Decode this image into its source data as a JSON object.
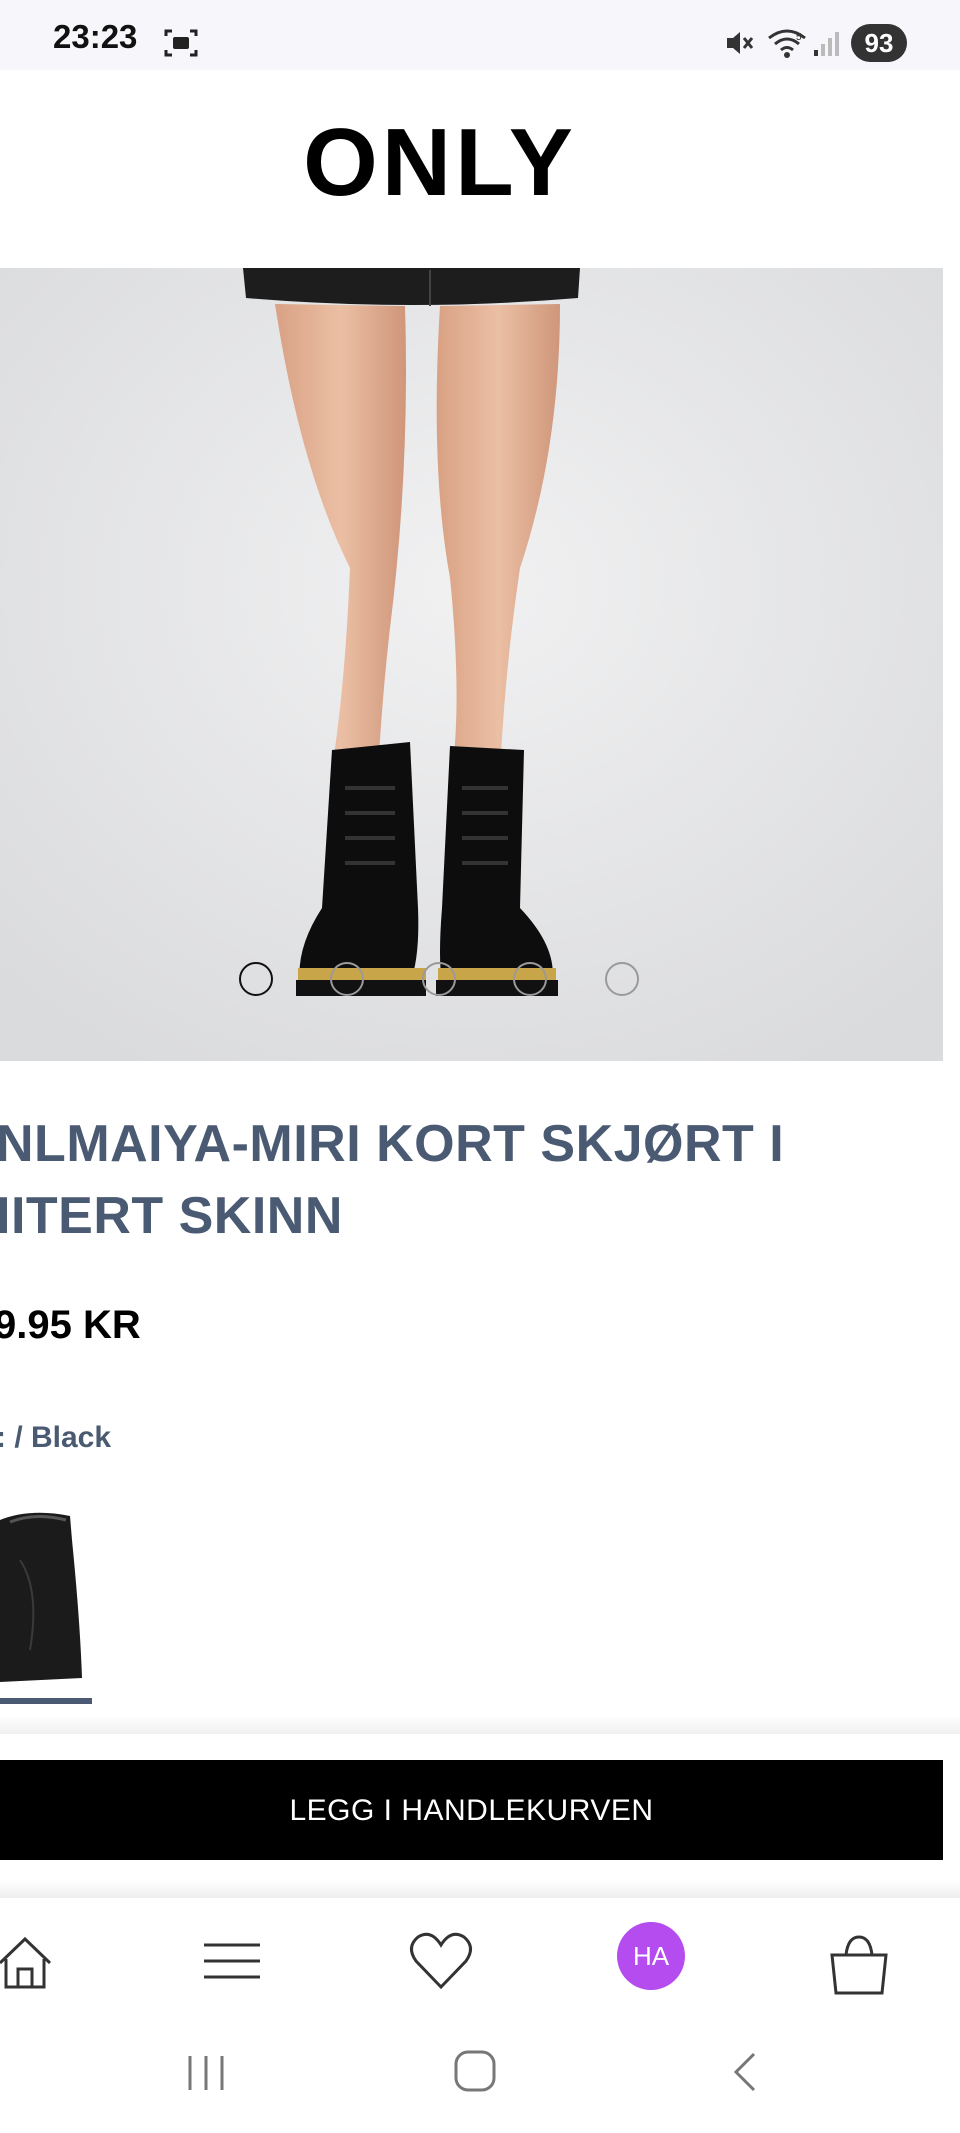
{
  "status_bar": {
    "time": "23:23",
    "battery": "93",
    "icons": [
      "screenshot-icon",
      "mute-icon",
      "wifi-icon",
      "signal-icon"
    ]
  },
  "header": {
    "brand": "ONLY"
  },
  "gallery": {
    "image_count": 5,
    "active_index": 0
  },
  "product": {
    "title": "NLMAIYA-MIRI KORT SKJØRT I IITERT SKINN",
    "price": "9.95 KR",
    "color": ": / Black"
  },
  "cart": {
    "add_label": "LEGG I HANDLEKURVEN"
  },
  "bottom_nav": {
    "items": [
      "home-icon",
      "menu-icon",
      "heart-icon",
      "account-avatar",
      "bag-icon"
    ],
    "avatar_initials": "HA"
  },
  "system_nav": {
    "items": [
      "recent-apps",
      "home",
      "back"
    ]
  },
  "colors": {
    "title": "#4a5a72",
    "button_bg": "#000000",
    "avatar": "#b44cf0"
  }
}
